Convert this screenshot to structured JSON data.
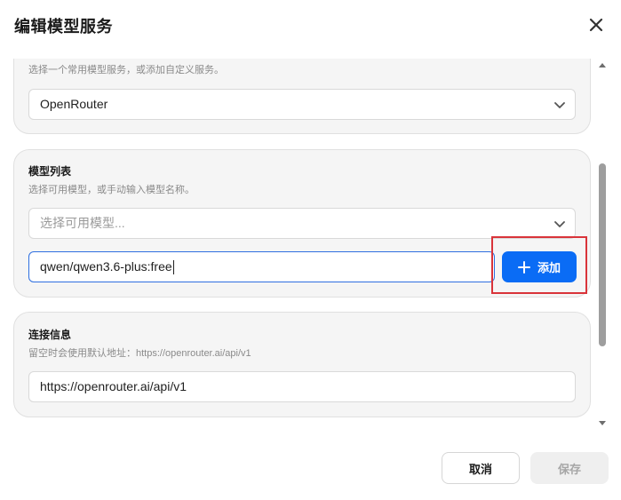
{
  "dialog": {
    "title": "编辑模型服务",
    "close_icon": "close-icon"
  },
  "provider_section": {
    "description": "选择一个常用模型服务，或添加自定义服务。",
    "selected_value": "OpenRouter"
  },
  "models_section": {
    "title": "模型列表",
    "description": "选择可用模型，或手动输入模型名称。",
    "select_placeholder": "选择可用模型...",
    "input_value": "qwen/qwen3.6-plus:free",
    "add_label": "添加"
  },
  "connection_section": {
    "title": "连接信息",
    "description": "留空时会使用默认地址：https://openrouter.ai/api/v1",
    "url_value": "https://openrouter.ai/api/v1"
  },
  "footer": {
    "cancel_label": "取消",
    "save_label": "保存"
  },
  "colors": {
    "accent": "#0a6cf5",
    "highlight": "#d9343a"
  }
}
